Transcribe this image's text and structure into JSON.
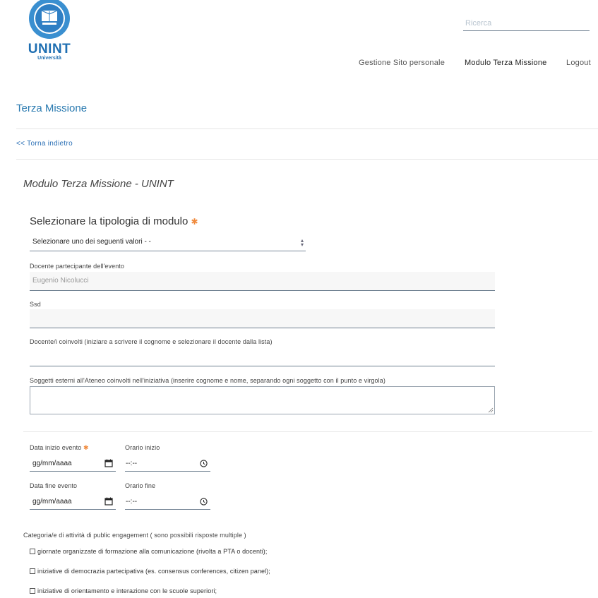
{
  "header": {
    "logo_text": "UNINT",
    "logo_subtext": "Università",
    "logo_seal_text": "Università degli Studi Internazionali di Roma",
    "search_placeholder": "Ricerca",
    "nav": [
      "Gestione Sito personale",
      "Modulo Terza Missione",
      "Logout"
    ]
  },
  "page": {
    "title": "Terza Missione",
    "back_link": "<< Torna indietro",
    "form_title": "Modulo Terza Missione - UNINT"
  },
  "form": {
    "tipologia": {
      "label": "Selezionare la tipologia di modulo",
      "value": "Selezionare uno dei seguenti valori - -"
    },
    "docente": {
      "label": "Docente partecipante dell'evento",
      "value": "Eugenio Nicolucci"
    },
    "ssd": {
      "label": "Ssd",
      "value": ""
    },
    "docenti_coinvolti": {
      "label": "Docente/i coinvolti (iniziare a scrivere il cognome e selezionare il docente dalla lista)",
      "value": ""
    },
    "soggetti_esterni": {
      "label": "Soggetti esterni all'Ateneo coinvolti nell'iniziativa (inserire cognome e nome, separando ogni soggetto con il punto e virgola)"
    },
    "data_inizio": {
      "label": "Data inizio evento",
      "value": "gg/mm/aaaa"
    },
    "orario_inizio": {
      "label": "Orario inizio",
      "value": "--:--"
    },
    "data_fine": {
      "label": "Data fine evento",
      "value": "gg/mm/aaaa"
    },
    "orario_fine": {
      "label": "Orario fine",
      "value": "--:--"
    },
    "required_mark": "✱",
    "categorie": {
      "label": "Categoria/e di attività di public engagement ( sono possibili risposte multiple )",
      "options": [
        "giornate organizzate di formazione alla comunicazione (rivolta a PTA o docenti);",
        "iniziative di democrazia partecipativa (es. consensus conferences, citizen panel);",
        "iniziative di orientamento e interazione con le scuole superiori;"
      ]
    }
  },
  "colors": {
    "link": "#2a7ab0",
    "required": "#f08a3c",
    "brand": "#1f6fb2"
  }
}
